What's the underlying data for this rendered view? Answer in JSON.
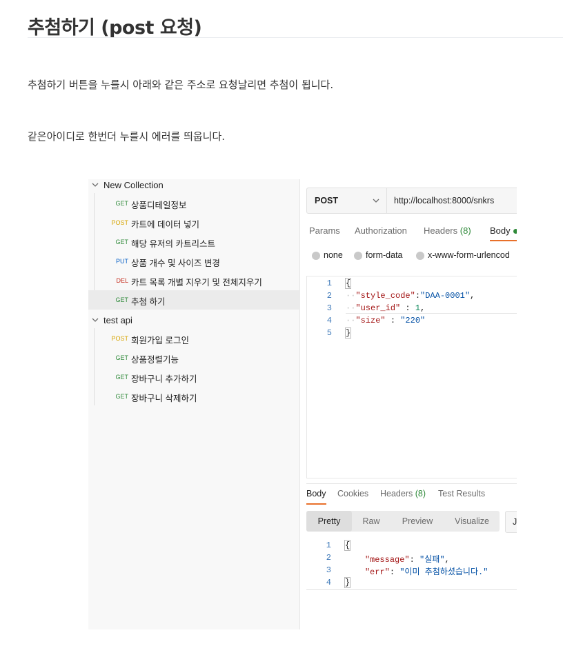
{
  "doc": {
    "title": "추첨하기 (post 요청)",
    "para1": "추첨하기 버튼을 누를시 아래와 같은 주소로 요청날리면 추첨이 됩니다.",
    "para2": "같은아이디로 한번더 누를시 에러를 띄웁니다."
  },
  "sidebar": {
    "collections": [
      {
        "name": "New Collection",
        "requests": [
          {
            "method": "GET",
            "name": "상품디테일정보"
          },
          {
            "method": "POST",
            "name": "카트에 데이터 넣기"
          },
          {
            "method": "GET",
            "name": "해당 유저의 카트리스트"
          },
          {
            "method": "PUT",
            "name": "상품 개수 및 사이즈 변경"
          },
          {
            "method": "DEL",
            "name": "카트 목록 개별 지우기 및 전체지우기"
          },
          {
            "method": "GET",
            "name": "추첨 하기"
          }
        ]
      },
      {
        "name": "test api",
        "requests": [
          {
            "method": "POST",
            "name": "회원가입 로그인"
          },
          {
            "method": "GET",
            "name": "상품정렬기능"
          },
          {
            "method": "GET",
            "name": "장바구니 추가하기"
          },
          {
            "method": "GET",
            "name": "장바구니 삭제하기"
          }
        ]
      }
    ]
  },
  "request": {
    "method": "POST",
    "url": "http://localhost:8000/snkrs",
    "tabs": [
      {
        "label": "Params",
        "count": ""
      },
      {
        "label": "Authorization",
        "count": ""
      },
      {
        "label": "Headers",
        "count": "(8)"
      },
      {
        "label": "Body",
        "count": ""
      }
    ],
    "body_modes": [
      "none",
      "form-data",
      "x-www-form-urlencod"
    ],
    "line_numbers": [
      "1",
      "2",
      "3",
      "4",
      "5"
    ],
    "body": {
      "open": "{",
      "close": "}",
      "style_code_key": "\"style_code\"",
      "style_code_value": "\"DAA-0001\"",
      "user_id_key": "\"user_id\"",
      "user_id_value": "1",
      "size_key": "\"size\"",
      "size_value": "\"220\""
    }
  },
  "response": {
    "tabs": [
      {
        "label": "Body",
        "count": ""
      },
      {
        "label": "Cookies",
        "count": ""
      },
      {
        "label": "Headers",
        "count": "(8)"
      },
      {
        "label": "Test Results",
        "count": ""
      }
    ],
    "views": [
      "Pretty",
      "Raw",
      "Preview",
      "Visualize"
    ],
    "format": "J",
    "line_numbers": [
      "1",
      "2",
      "3",
      "4"
    ],
    "body": {
      "open": "{",
      "close": "}",
      "message_key": "\"message\"",
      "message_value": "\"실패\"",
      "err_key": "\"err\"",
      "err_value": "\"이미 추첨하셨습니다.\""
    }
  },
  "colors": {
    "accent": "#e8702a",
    "get": "#2f8a3a",
    "post": "#d6a400",
    "put": "#0a62c7",
    "del": "#c42b1c"
  }
}
